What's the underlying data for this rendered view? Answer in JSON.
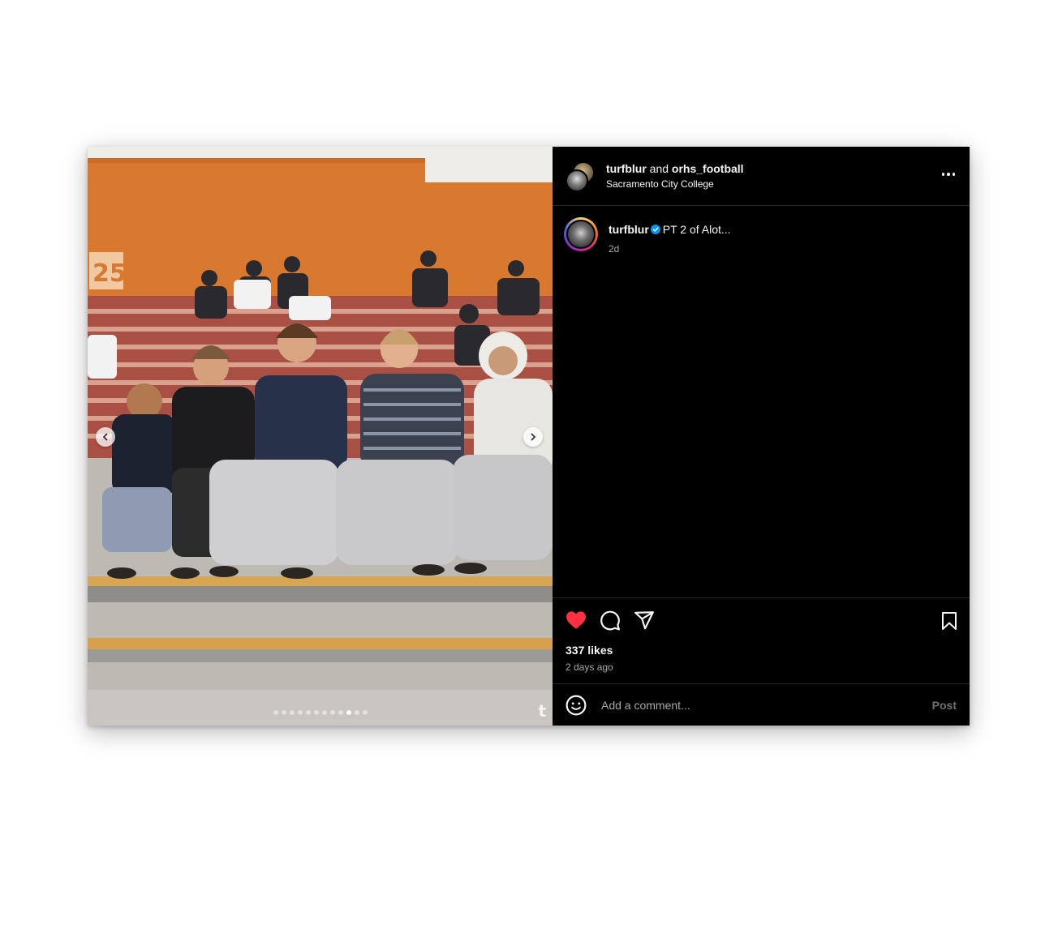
{
  "header": {
    "username_primary": "turfblur",
    "connector": "and",
    "username_secondary": "orhs_football",
    "location": "Sacramento City College"
  },
  "caption": {
    "username": "turfblur",
    "text": "PT 2 of Alot...",
    "time": "2d"
  },
  "media": {
    "total_slides": 12,
    "active_slide_index": 9,
    "watermark": "t"
  },
  "stats": {
    "likes": "337 likes",
    "posted": "2 days ago"
  },
  "comment_box": {
    "placeholder": "Add a comment...",
    "post_label": "Post"
  },
  "colors": {
    "like": "#ff3040",
    "verified": "#0095f6",
    "background": "#000000"
  },
  "icons": [
    "heart-icon",
    "comment-icon",
    "share-icon",
    "bookmark-icon",
    "emoji-icon",
    "more-icon",
    "chevron-left-icon",
    "chevron-right-icon"
  ]
}
